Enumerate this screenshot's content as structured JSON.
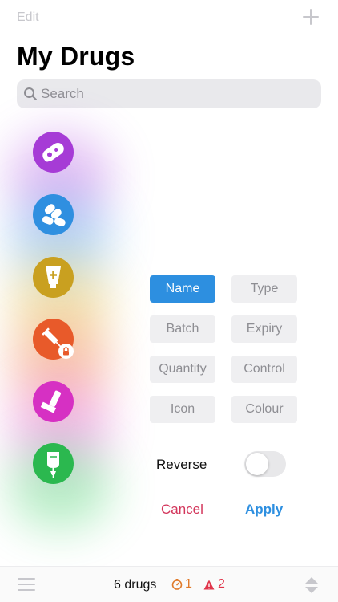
{
  "topbar": {
    "edit_label": "Edit",
    "add_icon": "plus-icon"
  },
  "page_title": "My Drugs",
  "search": {
    "placeholder": "Search",
    "value": "",
    "icon": "magnifier-icon"
  },
  "drugs": [
    {
      "icon": "bacteria-icon",
      "color": "#a63bd6"
    },
    {
      "icon": "pills-icon",
      "color": "#2f8fe0"
    },
    {
      "icon": "cream-tube-icon",
      "color": "#c9a020"
    },
    {
      "icon": "syringe-icon",
      "color": "#e85a2a",
      "locked": true
    },
    {
      "icon": "inhaler-icon",
      "color": "#d630c3"
    },
    {
      "icon": "iv-bag-icon",
      "color": "#2bb84f"
    }
  ],
  "sort": {
    "options": [
      "Name",
      "Type",
      "Batch",
      "Expiry",
      "Quantity",
      "Control",
      "Icon",
      "Colour"
    ],
    "selected": "Name",
    "reverse_label": "Reverse",
    "reverse_on": false,
    "cancel_label": "Cancel",
    "apply_label": "Apply"
  },
  "bottombar": {
    "count_text": "6 drugs",
    "expiry_count": "1",
    "warning_count": "2",
    "expiry_color": "#e07a2a",
    "warning_color": "#e0344a"
  },
  "colors": {
    "accent": "#2d8fe0",
    "destructive": "#d3355b"
  }
}
